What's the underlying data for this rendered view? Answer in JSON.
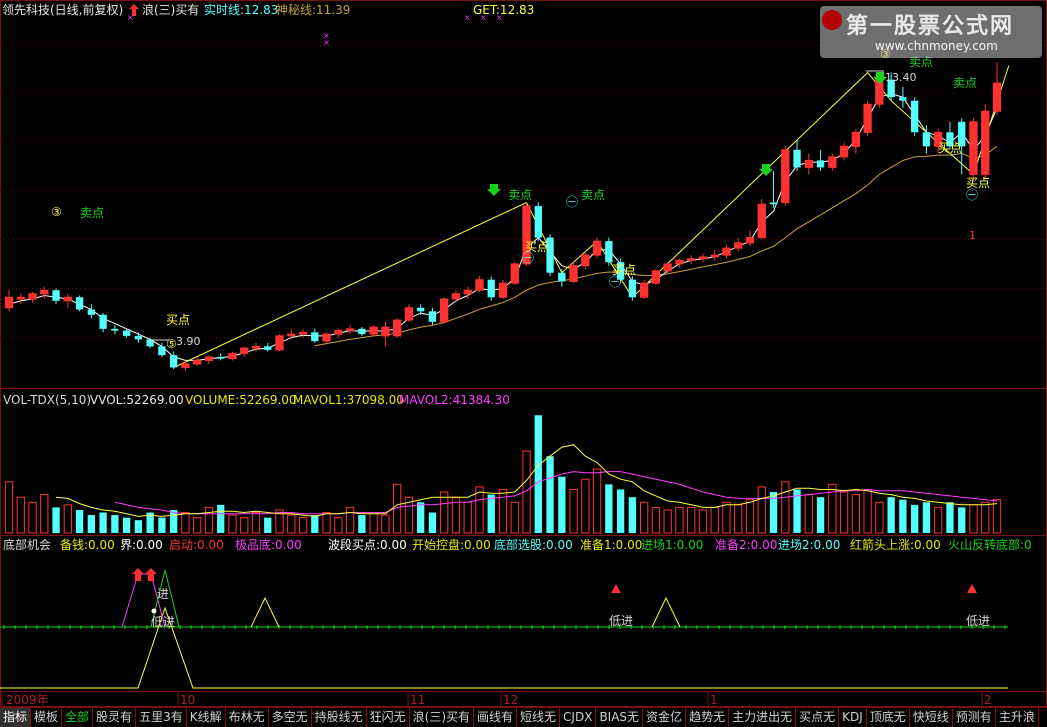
{
  "header": {
    "stock": "领先科技(日线,前复权)",
    "wave": "浪(三)买有",
    "realtime": "实时线:12.83",
    "mystery": "神秘线:11.39",
    "get": "GET:12.83",
    "up_arrow_icon": "red-up-arrow"
  },
  "watermark": {
    "title": "第一股票公式网",
    "url": "www.chnmoney.com"
  },
  "price_chart": {
    "candles": [
      [
        5.6,
        6.1,
        5.5,
        5.9,
        1
      ],
      [
        5.9,
        6.0,
        5.7,
        5.85,
        1
      ],
      [
        5.85,
        6.05,
        5.75,
        6.0,
        1
      ],
      [
        6.0,
        6.2,
        5.85,
        6.1,
        1
      ],
      [
        6.1,
        6.15,
        5.7,
        5.8,
        0
      ],
      [
        5.8,
        6.0,
        5.6,
        5.9,
        1
      ],
      [
        5.9,
        5.95,
        5.5,
        5.55,
        0
      ],
      [
        5.55,
        5.7,
        5.3,
        5.4,
        0
      ],
      [
        5.4,
        5.45,
        4.9,
        5.0,
        0
      ],
      [
        5.0,
        5.1,
        4.85,
        4.95,
        0
      ],
      [
        4.95,
        5.0,
        4.75,
        4.8,
        0
      ],
      [
        4.8,
        4.9,
        4.6,
        4.7,
        0
      ],
      [
        4.7,
        4.75,
        4.45,
        4.5,
        0
      ],
      [
        4.5,
        4.6,
        4.2,
        4.25,
        0
      ],
      [
        4.25,
        4.35,
        3.85,
        3.9,
        0
      ],
      [
        3.9,
        4.1,
        3.8,
        4.0,
        1
      ],
      [
        4.0,
        4.2,
        3.95,
        4.1,
        1
      ],
      [
        4.1,
        4.25,
        4.0,
        4.2,
        1
      ],
      [
        4.2,
        4.3,
        4.1,
        4.15,
        0
      ],
      [
        4.15,
        4.35,
        4.1,
        4.3,
        1
      ],
      [
        4.3,
        4.5,
        4.2,
        4.45,
        1
      ],
      [
        4.45,
        4.6,
        4.35,
        4.5,
        1
      ],
      [
        4.5,
        4.6,
        4.35,
        4.4,
        0
      ],
      [
        4.4,
        4.85,
        4.35,
        4.8,
        1
      ],
      [
        4.8,
        5.0,
        4.7,
        4.85,
        1
      ],
      [
        4.85,
        5.0,
        4.75,
        4.9,
        1
      ],
      [
        4.9,
        5.0,
        4.6,
        4.65,
        0
      ],
      [
        4.65,
        4.9,
        4.6,
        4.85,
        1
      ],
      [
        4.85,
        5.0,
        4.75,
        4.95,
        1
      ],
      [
        4.95,
        5.1,
        4.85,
        5.0,
        1
      ],
      [
        5.0,
        5.05,
        4.8,
        4.85,
        0
      ],
      [
        4.85,
        5.1,
        4.8,
        5.05,
        1
      ],
      [
        5.05,
        5.2,
        4.5,
        4.8,
        1
      ],
      [
        4.8,
        5.3,
        4.75,
        5.25,
        1
      ],
      [
        5.25,
        5.7,
        5.2,
        5.6,
        1
      ],
      [
        5.6,
        5.7,
        5.4,
        5.5,
        0
      ],
      [
        5.5,
        5.6,
        5.1,
        5.2,
        0
      ],
      [
        5.2,
        5.9,
        5.15,
        5.85,
        1
      ],
      [
        5.85,
        6.1,
        5.75,
        6.0,
        1
      ],
      [
        6.0,
        6.2,
        5.85,
        6.1,
        1
      ],
      [
        6.1,
        6.5,
        6.05,
        6.4,
        1
      ],
      [
        6.4,
        6.5,
        5.8,
        5.9,
        0
      ],
      [
        5.9,
        6.4,
        5.85,
        6.3,
        1
      ],
      [
        6.3,
        6.9,
        6.25,
        6.85,
        1
      ],
      [
        6.85,
        8.6,
        6.8,
        8.5,
        1
      ],
      [
        8.5,
        8.6,
        7.5,
        7.6,
        0
      ],
      [
        7.6,
        7.7,
        6.5,
        6.6,
        0
      ],
      [
        6.6,
        6.7,
        6.2,
        6.35,
        0
      ],
      [
        6.35,
        6.9,
        6.3,
        6.8,
        1
      ],
      [
        6.8,
        7.2,
        6.7,
        7.1,
        1
      ],
      [
        7.1,
        7.6,
        7.0,
        7.5,
        1
      ],
      [
        7.5,
        7.6,
        6.8,
        6.9,
        0
      ],
      [
        6.9,
        7.0,
        6.3,
        6.4,
        0
      ],
      [
        6.4,
        6.5,
        5.8,
        5.9,
        0
      ],
      [
        5.9,
        6.4,
        5.85,
        6.3,
        1
      ],
      [
        6.3,
        6.7,
        6.25,
        6.65,
        1
      ],
      [
        6.65,
        6.9,
        6.55,
        6.85,
        1
      ],
      [
        6.85,
        7.0,
        6.75,
        6.95,
        1
      ],
      [
        6.95,
        7.1,
        6.85,
        7.0,
        1
      ],
      [
        7.0,
        7.15,
        6.9,
        7.05,
        1
      ],
      [
        7.05,
        7.25,
        6.95,
        7.1,
        1
      ],
      [
        7.1,
        7.4,
        7.0,
        7.3,
        1
      ],
      [
        7.3,
        7.6,
        7.2,
        7.45,
        1
      ],
      [
        7.45,
        7.8,
        7.35,
        7.6,
        1
      ],
      [
        7.6,
        8.7,
        7.55,
        8.55,
        1
      ],
      [
        8.55,
        9.5,
        8.45,
        8.6,
        0
      ],
      [
        8.6,
        10.2,
        8.5,
        10.1,
        1
      ],
      [
        10.1,
        10.4,
        9.5,
        9.6,
        0
      ],
      [
        9.6,
        10.0,
        9.4,
        9.8,
        1
      ],
      [
        9.8,
        10.1,
        9.5,
        9.6,
        0
      ],
      [
        9.6,
        10.0,
        9.5,
        9.9,
        1
      ],
      [
        9.9,
        10.3,
        9.8,
        10.2,
        1
      ],
      [
        10.2,
        10.7,
        10.0,
        10.6,
        1
      ],
      [
        10.6,
        11.5,
        10.5,
        11.4,
        1
      ],
      [
        11.4,
        12.2,
        11.3,
        12.1,
        1
      ],
      [
        12.1,
        12.3,
        11.5,
        11.6,
        0
      ],
      [
        11.6,
        11.9,
        11.3,
        11.5,
        0
      ],
      [
        11.5,
        11.6,
        10.5,
        10.6,
        0
      ],
      [
        10.6,
        10.8,
        10.0,
        10.2,
        0
      ],
      [
        10.2,
        10.7,
        10.0,
        10.6,
        1
      ],
      [
        10.6,
        10.9,
        10.1,
        10.2,
        0
      ],
      [
        10.2,
        11.0,
        9.4,
        10.9,
        0
      ],
      [
        10.9,
        11.0,
        9.2,
        9.4,
        1
      ],
      [
        9.4,
        11.4,
        9.3,
        11.2,
        1
      ],
      [
        11.2,
        12.6,
        11.1,
        12.0,
        1
      ]
    ],
    "ymin": 3.4,
    "ymax": 13.8,
    "ma_short": [
      5.7,
      5.8,
      5.85,
      5.95,
      5.9,
      5.85,
      5.7,
      5.55,
      5.3,
      5.15,
      5.0,
      4.85,
      4.7,
      4.5,
      4.2,
      4.1,
      4.1,
      4.15,
      4.18,
      4.22,
      4.32,
      4.42,
      4.45,
      4.6,
      4.75,
      4.82,
      4.8,
      4.8,
      4.87,
      4.95,
      4.93,
      4.95,
      4.93,
      5.02,
      5.3,
      5.45,
      5.38,
      5.55,
      5.8,
      5.95,
      6.15,
      6.1,
      6.15,
      6.45,
      7.3,
      7.6,
      7.2,
      6.8,
      6.7,
      6.9,
      7.25,
      7.25,
      6.85,
      6.35,
      6.25,
      6.4,
      6.65,
      6.85,
      6.95,
      7.0,
      7.05,
      7.2,
      7.35,
      7.5,
      8.05,
      8.35,
      9.2,
      9.65,
      9.75,
      9.75,
      9.8,
      10.0,
      10.4,
      11.0,
      11.6,
      11.7,
      11.6,
      11.1,
      10.6,
      10.5,
      10.3,
      10.6,
      10.1,
      10.5,
      11.3
    ],
    "ma_long": [
      null,
      null,
      null,
      null,
      null,
      null,
      null,
      null,
      null,
      null,
      null,
      null,
      null,
      null,
      null,
      null,
      null,
      null,
      null,
      null,
      null,
      null,
      null,
      null,
      null,
      null,
      4.52,
      4.58,
      4.64,
      4.7,
      4.75,
      4.8,
      4.83,
      4.88,
      4.97,
      5.05,
      5.1,
      5.18,
      5.3,
      5.42,
      5.56,
      5.65,
      5.75,
      5.9,
      6.1,
      6.25,
      6.32,
      6.37,
      6.42,
      6.5,
      6.58,
      6.62,
      6.6,
      6.55,
      6.52,
      6.52,
      6.57,
      6.63,
      6.7,
      6.77,
      6.83,
      6.9,
      6.98,
      7.06,
      7.22,
      7.35,
      7.6,
      7.85,
      8.05,
      8.25,
      8.45,
      8.65,
      8.85,
      9.1,
      9.4,
      9.6,
      9.8,
      9.9,
      9.92,
      9.95,
      9.95,
      10.0,
      9.85,
      9.95,
      10.2
    ],
    "zigzag": [
      [
        14,
        3.9
      ],
      [
        44,
        8.6
      ],
      [
        47,
        6.6
      ],
      [
        50,
        7.5
      ],
      [
        53,
        5.9
      ],
      [
        73,
        12.3
      ],
      [
        75,
        11.5
      ],
      [
        82,
        9.4
      ],
      [
        85,
        12.5
      ]
    ],
    "labels": {
      "sell": "卖点",
      "buy": "买点",
      "low_value": "3.90",
      "high_value": "13.40",
      "wave_mark_3": "③",
      "wave_mark_5": "⑤",
      "wave_mark_n": "㊀",
      "wave_mark_2": "㊁",
      "small_one": "1"
    }
  },
  "volume": {
    "header": {
      "name": "VOL-TDX(5,10)",
      "vvol": "VVOL:52269.00",
      "volume": "VOLUME:52269.00",
      "mavol1": "MAVOL1:37098.00",
      "mavol2": "MAVOL2:41384.30"
    },
    "bars": [
      40,
      28,
      24,
      30,
      20,
      22,
      18,
      14,
      16,
      14,
      12,
      10,
      16,
      12,
      18,
      16,
      12,
      20,
      22,
      14,
      12,
      16,
      12,
      18,
      14,
      12,
      14,
      16,
      12,
      20,
      14,
      16,
      14,
      38,
      28,
      24,
      16,
      32,
      28,
      24,
      36,
      30,
      34,
      24,
      64,
      92,
      60,
      44,
      34,
      42,
      50,
      38,
      34,
      28,
      24,
      20,
      18,
      20,
      20,
      18,
      20,
      24,
      22,
      26,
      36,
      32,
      40,
      34,
      30,
      28,
      38,
      32,
      30,
      34,
      24,
      28,
      26,
      22,
      24,
      20,
      24,
      20,
      22,
      24,
      26
    ],
    "ma1": [
      null,
      null,
      null,
      null,
      28,
      27,
      23,
      20,
      18,
      17,
      15,
      13,
      14,
      13,
      14,
      15,
      15,
      16,
      17,
      17,
      16,
      17,
      16,
      15,
      15,
      14,
      13,
      15,
      15,
      16,
      15,
      15,
      15,
      22,
      24,
      26,
      28,
      28,
      28,
      28,
      32,
      31,
      31,
      32,
      41,
      53,
      60,
      67,
      69,
      60,
      55,
      46,
      42,
      40,
      33,
      29,
      25,
      24,
      22,
      20,
      20,
      22,
      22,
      24,
      27,
      29,
      32,
      35,
      35,
      34,
      34,
      33,
      34,
      33,
      31,
      30,
      28,
      27,
      25,
      24,
      23,
      22,
      22,
      22,
      23
    ],
    "ma2": [
      null,
      null,
      null,
      null,
      null,
      null,
      null,
      null,
      null,
      24,
      22,
      20,
      19,
      18,
      16,
      15,
      15,
      15,
      15,
      15,
      15,
      15,
      15,
      16,
      16,
      15,
      15,
      15,
      15,
      16,
      16,
      16,
      16,
      20,
      21,
      22,
      22,
      23,
      24,
      24,
      26,
      27,
      28,
      29,
      33,
      40,
      43,
      46,
      48,
      47,
      47,
      48,
      48,
      46,
      44,
      42,
      40,
      38,
      35,
      32,
      30,
      28,
      27,
      27,
      27,
      27,
      28,
      29,
      30,
      31,
      32,
      33,
      33,
      34,
      33,
      33,
      33,
      32,
      31,
      30,
      29,
      28,
      27,
      26,
      25
    ],
    "ymax": 100
  },
  "indicator": {
    "header": [
      {
        "t": "底部机会",
        "c": "#d8d8d8"
      },
      {
        "t": "备钱:0.00",
        "c": "#e8e800"
      },
      {
        "t": "界:0.00",
        "c": "#ffffff"
      },
      {
        "t": "启动:0.00",
        "c": "#ff3030"
      },
      {
        "t": "极品底:0.00",
        "c": "#ff3cff"
      },
      {
        "t": "波段买点:0.00",
        "c": "#ffffff"
      },
      {
        "t": "开始控盘:0.00",
        "c": "#e8e800"
      },
      {
        "t": "底部选股:0.00",
        "c": "#54ffff"
      },
      {
        "t": "准备1:0.00",
        "c": "#e8e800"
      },
      {
        "t": "进场1:0.00",
        "c": "#19d219"
      },
      {
        "t": "准备2:0.00",
        "c": "#ff3cff"
      },
      {
        "t": "进场2:0.00",
        "c": "#54ffff"
      },
      {
        "t": "红箭头上涨:0.00",
        "c": "#e8e800"
      },
      {
        "t": "火山反转底部:0",
        "c": "#19d219"
      }
    ],
    "low_entry": "低进",
    "markers": {
      "up_arrow_icon": "red-up-arrow-icon",
      "triangle_icon": "red-triangle-icon"
    }
  },
  "time_axis": {
    "labels": [
      "2009年",
      "10",
      "11",
      "12",
      "1",
      "2"
    ]
  },
  "tabs": [
    {
      "label": "指标",
      "active": true,
      "green": false
    },
    {
      "label": "模板",
      "active": false,
      "green": false
    },
    {
      "label": "全部",
      "active": false,
      "green": true
    },
    {
      "label": "股灵有",
      "active": false,
      "green": false
    },
    {
      "label": "五里3有",
      "active": false,
      "green": false
    },
    {
      "label": "K线解",
      "active": false,
      "green": false
    },
    {
      "label": "布林无",
      "active": false,
      "green": false
    },
    {
      "label": "多空无",
      "active": false,
      "green": false
    },
    {
      "label": "持股线无",
      "active": false,
      "green": false
    },
    {
      "label": "狂闪无",
      "active": false,
      "green": false
    },
    {
      "label": "浪(三)买有",
      "active": false,
      "green": false
    },
    {
      "label": "画线有",
      "active": false,
      "green": false
    },
    {
      "label": "短线无",
      "active": false,
      "green": false
    },
    {
      "label": "CJDX",
      "active": false,
      "green": false
    },
    {
      "label": "BIAS无",
      "active": false,
      "green": false
    },
    {
      "label": "资金亿",
      "active": false,
      "green": false
    },
    {
      "label": "趋势无",
      "active": false,
      "green": false
    },
    {
      "label": "主力进出无",
      "active": false,
      "green": false
    },
    {
      "label": "买点无",
      "active": false,
      "green": false
    },
    {
      "label": "KDJ",
      "active": false,
      "green": false
    },
    {
      "label": "顶底无",
      "active": false,
      "green": false
    },
    {
      "label": "快短线",
      "active": false,
      "green": false
    },
    {
      "label": "预测有",
      "active": false,
      "green": false
    },
    {
      "label": "主升浪",
      "active": false,
      "green": false
    }
  ],
  "colors": {
    "up": "#ff3232",
    "down": "#54ffff",
    "ma_short": "#ffffff",
    "ma_long": "#c8a040",
    "zigzag": "#ffff40",
    "divider": "#7a1010",
    "vol_ma1": "#ffff40",
    "vol_ma2": "#ff3cff"
  }
}
